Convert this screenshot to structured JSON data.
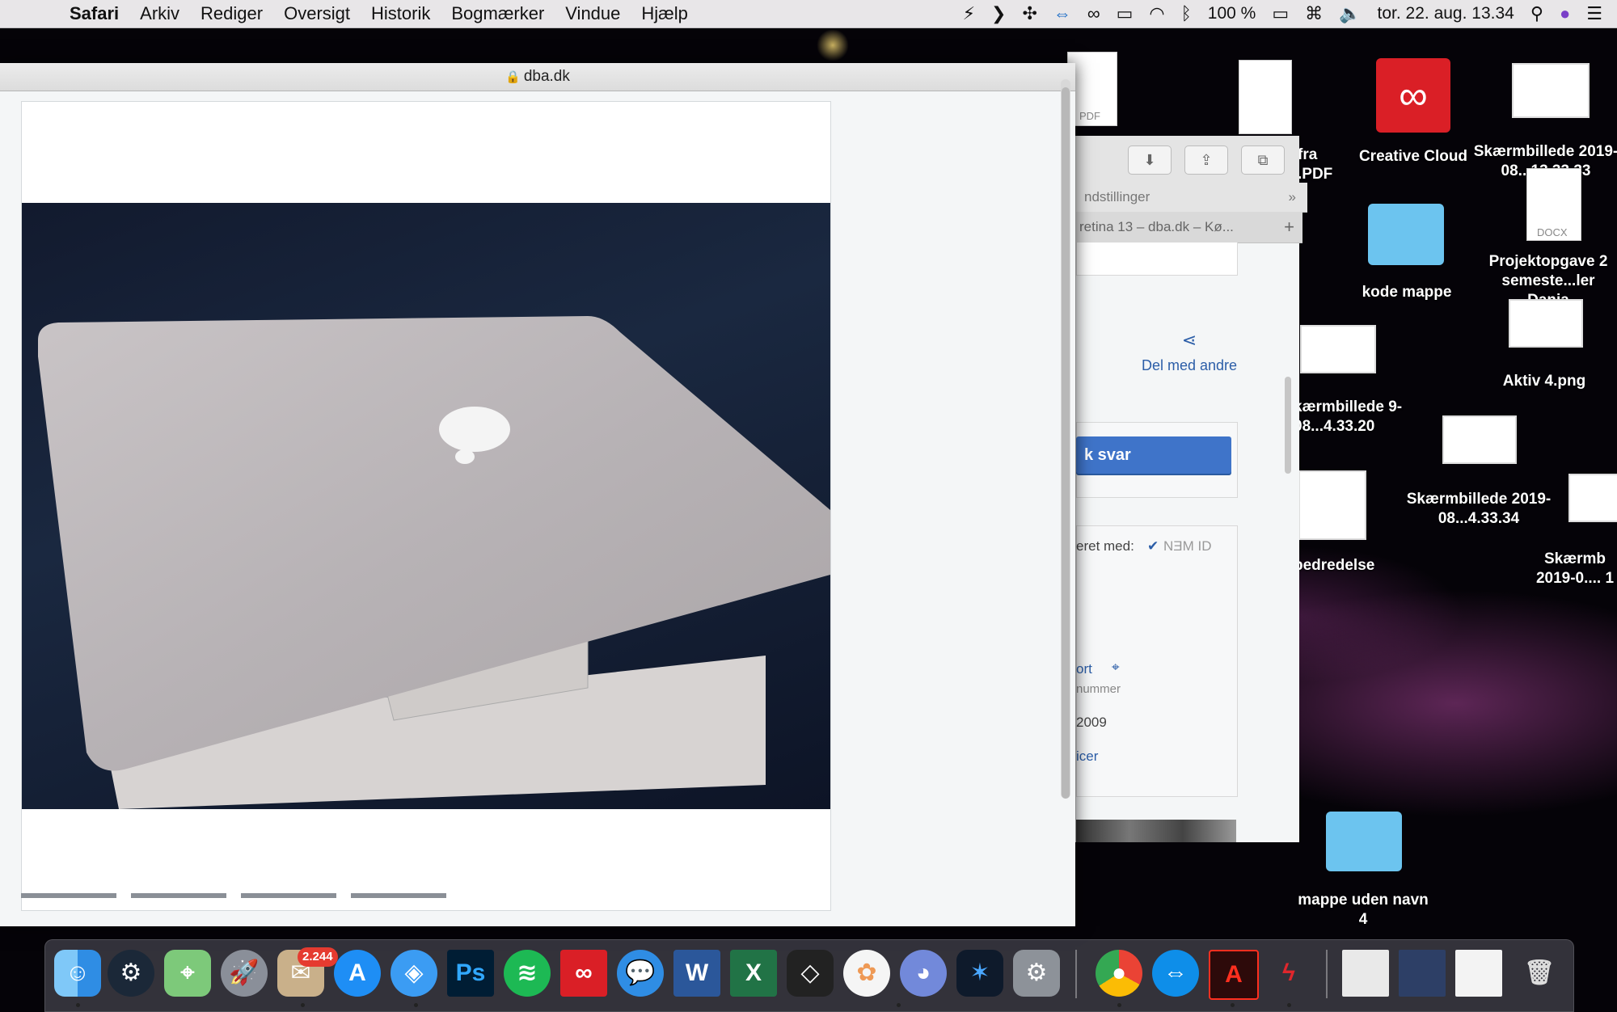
{
  "menubar": {
    "app": "Safari",
    "items": [
      "Arkiv",
      "Rediger",
      "Oversigt",
      "Historik",
      "Bogmærker",
      "Vindue",
      "Hjælp"
    ],
    "battery": "100 %",
    "datetime": "tor. 22. aug. 13.34"
  },
  "safari": {
    "title": "dba.dk"
  },
  "behind_window": {
    "favorites_label": "ndstillinger",
    "tab_label": "retina 13 – dba.dk – Kø...",
    "share_label": "Del med andre",
    "reply_label": "k svar",
    "verified_label": "eret med:",
    "nemid_label": "NƎM ID",
    "link1": "ort",
    "text_nummer": "nummer",
    "text_year": "2009",
    "link2": "icer"
  },
  "desktop": {
    "icons": [
      {
        "label": "Creative Cloud"
      },
      {
        "label": "Skærmbillede 2019-08...13.33.33"
      },
      {
        "label": "fra .PDF"
      },
      {
        "label": "kode mappe"
      },
      {
        "label": "Projektopgave 2 semeste...ler Dania"
      },
      {
        "label": "kærmbillede 9-08...4.33.20"
      },
      {
        "label": "Aktiv 4.png"
      },
      {
        "label": "Skærmbillede 2019-08...4.33.34"
      },
      {
        "label": "Skærmb 2019-0.... 1"
      },
      {
        "label": "bedredelse"
      },
      {
        "label": "mappe uden navn 4"
      }
    ],
    "doc_labels": {
      "pdf": "PDF",
      "docx": "DOCX"
    }
  },
  "dock": {
    "mail_badge": "2.244"
  },
  "colors": {
    "accent": "#3f74c9",
    "link": "#2c5ea8"
  }
}
